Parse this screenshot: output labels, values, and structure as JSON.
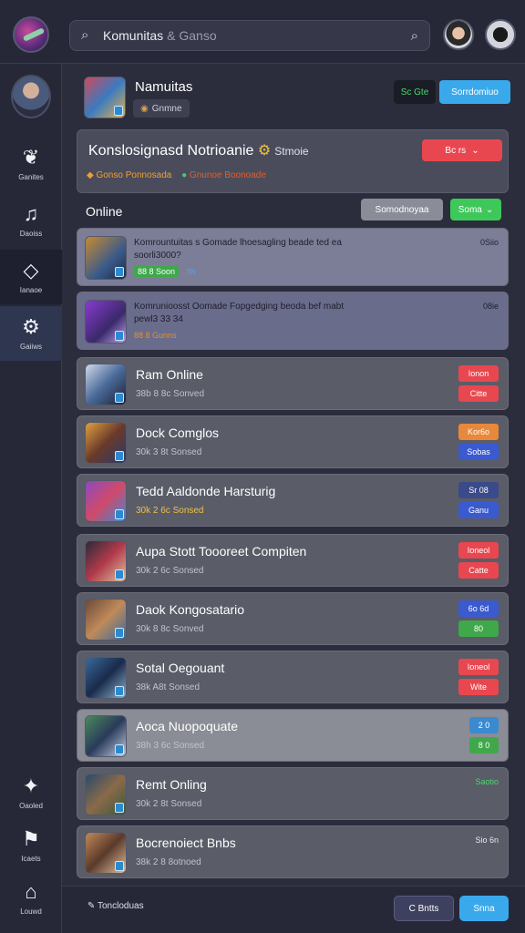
{
  "search": {
    "value": "Komunitas",
    "hint": "& Ganso"
  },
  "sidebar": {
    "items": [
      {
        "label": "Ganites",
        "icon": "hearts-icon"
      },
      {
        "label": "Daoiss",
        "icon": "music-note-icon"
      },
      {
        "label": "Ianaoe",
        "icon": "cube-icon"
      },
      {
        "label": "Gaiiws",
        "icon": "gear-icon"
      },
      {
        "label": "Oaoled",
        "icon": "sparkle-icon"
      },
      {
        "label": "Icaets",
        "icon": "flag-icon"
      },
      {
        "label": "Louwd",
        "icon": "home-icon"
      }
    ]
  },
  "profile": {
    "name": "Namuitas",
    "chip": "Gnmne",
    "dark_btn": "Sc Gte",
    "blue_btn": "Sorrdomiuo"
  },
  "notification": {
    "title": "Konslosignasd Notrioanie",
    "title_suffix": "Stmoie",
    "meta_1": "Gonso Ponnosada",
    "meta_2": "Gnunoe Boonoade",
    "button": "Bc rs"
  },
  "list": {
    "header": "Online",
    "sort_button": "Somodnoyaa",
    "save_button": "Soma"
  },
  "featured": [
    {
      "title": "Komrountuitas s Gomade lhoesagling beade ted ea",
      "subtitle": "soorli3000?",
      "stats": "88 8 Soon",
      "extra": "Ith",
      "right": "0Siio"
    },
    {
      "title": "Komrunioosst Oomade Fopgedging beoda bef mabt",
      "subtitle": "pewl3 33 34",
      "stats": "88 8 Gunns",
      "right": "08ie"
    }
  ],
  "rooms": [
    {
      "name": "Ram Online",
      "sub": "38b 8 8c Sonved",
      "tag1": "Ionon",
      "tag2": "Citte"
    },
    {
      "name": "Dock Comglos",
      "sub": "30k 3 8t Sonsed",
      "tag1": "Kor6o",
      "tag2": "Sobas"
    },
    {
      "name": "Tedd Aaldonde Harsturig",
      "sub": "30k 2 6c Sonsed",
      "tag1": "Sr 08",
      "tag2": "Ganu"
    },
    {
      "name": "Aupa Stott Toooreet Compiten",
      "sub": "30k 2 6c Sonsed",
      "tag1": "Ioneol",
      "tag2": "Catte"
    },
    {
      "name": "Daok Kongosatario",
      "sub": "30k 8 8c Sonved",
      "tag1": "6o 6d",
      "tag2": "80"
    },
    {
      "name": "Sotal Oegouant",
      "sub": "38k A8t Sonsed",
      "tag1": "Ioneol",
      "tag2": "Wite"
    },
    {
      "name": "Aoca Nuopoquate",
      "sub": "38h 3 6c Sonsed",
      "tag1": "2 0",
      "tag2": "8 0"
    },
    {
      "name": "Remt Onling",
      "sub": "30k 2 8t Sonsed",
      "tag1": "Saotio",
      "tag2": ""
    },
    {
      "name": "Bocrenoiect Bnbs",
      "sub": "38k 2 8 8otnoed",
      "tag1": "Sio 6n",
      "tag2": ""
    }
  ],
  "bottombar": {
    "label": "Toncloduas",
    "btn1": "C Bntts",
    "btn2": "Snna"
  },
  "colors": {
    "accent_blue": "#3aa9ec",
    "danger": "#e9474f",
    "success": "#3fc85a"
  }
}
